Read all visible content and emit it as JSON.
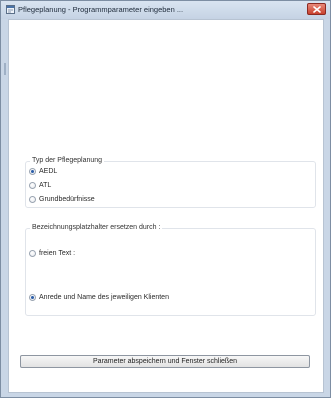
{
  "window": {
    "title": "Pflegeplanung - Programmparameter eingeben ..."
  },
  "plan_type_group": {
    "caption": "Typ der Pflegeplanung",
    "options": [
      {
        "label": "AEDL",
        "checked": true
      },
      {
        "label": "ATL",
        "checked": false
      },
      {
        "label": "Grundbedürfnisse",
        "checked": false
      }
    ]
  },
  "placeholder_group": {
    "caption": "Bezeichnungsplatzhalter ersetzen durch :",
    "options": [
      {
        "label": "freien Text :",
        "checked": false
      },
      {
        "label": "Anrede und Name des jeweiligen Klienten",
        "checked": true
      }
    ]
  },
  "footer": {
    "save_label": "Parameter abspeichern und Fenster schließen"
  },
  "icons": {
    "app": "window-app-icon",
    "close": "close-icon"
  },
  "colors": {
    "titlebar": "#c9d6e6",
    "close_button": "#c8412e",
    "radio_selected": "#2b5da8"
  }
}
